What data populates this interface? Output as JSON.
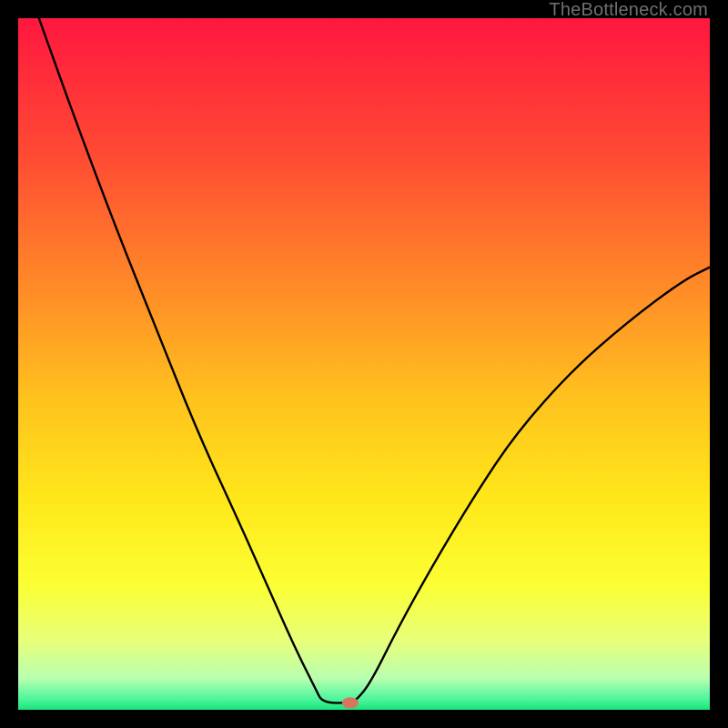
{
  "watermark": "TheBottleneck.com",
  "chart_data": {
    "type": "line",
    "title": "",
    "xlabel": "",
    "ylabel": "",
    "xlim": [
      0,
      100
    ],
    "ylim": [
      0,
      100
    ],
    "gradient_stops": [
      {
        "offset": 0.0,
        "color": "#ff173f"
      },
      {
        "offset": 0.2,
        "color": "#ff4b33"
      },
      {
        "offset": 0.4,
        "color": "#ff8e27"
      },
      {
        "offset": 0.55,
        "color": "#ffc21e"
      },
      {
        "offset": 0.7,
        "color": "#ffe81a"
      },
      {
        "offset": 0.82,
        "color": "#fbff33"
      },
      {
        "offset": 0.9,
        "color": "#e8ff7a"
      },
      {
        "offset": 0.955,
        "color": "#b8ffb0"
      },
      {
        "offset": 0.985,
        "color": "#4bf59c"
      },
      {
        "offset": 1.0,
        "color": "#19e37a"
      }
    ],
    "series": [
      {
        "name": "bottleneck-curve",
        "type": "line",
        "points": [
          {
            "x": 3,
            "y": 100
          },
          {
            "x": 8,
            "y": 86
          },
          {
            "x": 14,
            "y": 70
          },
          {
            "x": 20,
            "y": 55
          },
          {
            "x": 26,
            "y": 40
          },
          {
            "x": 32,
            "y": 27
          },
          {
            "x": 36,
            "y": 18
          },
          {
            "x": 40,
            "y": 9
          },
          {
            "x": 43,
            "y": 3
          },
          {
            "x": 44,
            "y": 1
          },
          {
            "x": 48,
            "y": 1
          },
          {
            "x": 49,
            "y": 1.5
          },
          {
            "x": 51,
            "y": 4
          },
          {
            "x": 55,
            "y": 12
          },
          {
            "x": 60,
            "y": 21
          },
          {
            "x": 66,
            "y": 31
          },
          {
            "x": 72,
            "y": 40
          },
          {
            "x": 80,
            "y": 49
          },
          {
            "x": 88,
            "y": 56
          },
          {
            "x": 96,
            "y": 62
          },
          {
            "x": 100,
            "y": 64
          }
        ]
      }
    ],
    "marker": {
      "x": 48,
      "y": 1,
      "rx": 9,
      "ry": 6,
      "color": "#d8745f"
    }
  }
}
